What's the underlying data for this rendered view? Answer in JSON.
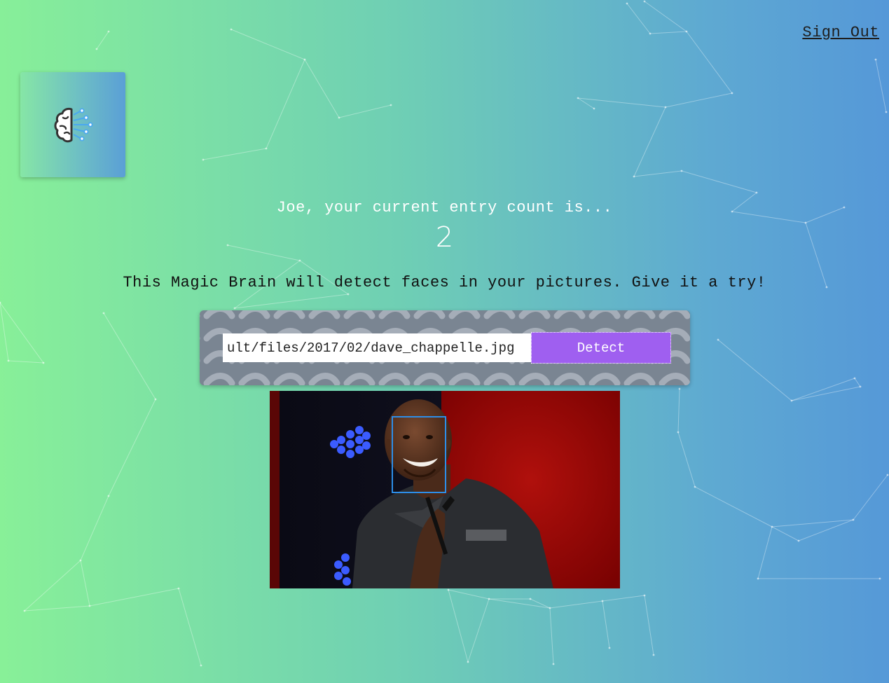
{
  "nav": {
    "sign_out": "Sign Out"
  },
  "logo": {
    "icon": "brain-icon"
  },
  "rank": {
    "message": "Joe, your current entry count is...",
    "count": "2"
  },
  "instructions": "This Magic Brain will detect faces in your pictures. Give it a try!",
  "form": {
    "image_url": "ult/files/2017/02/dave_chappelle.jpg",
    "detect_label": "Detect"
  },
  "colors": {
    "gradient_start": "#88f098",
    "gradient_end": "#5598d8",
    "detect_button": "#9f5ff0",
    "face_box": "#2d8ee8"
  },
  "detection": {
    "faces_detected": 1
  }
}
